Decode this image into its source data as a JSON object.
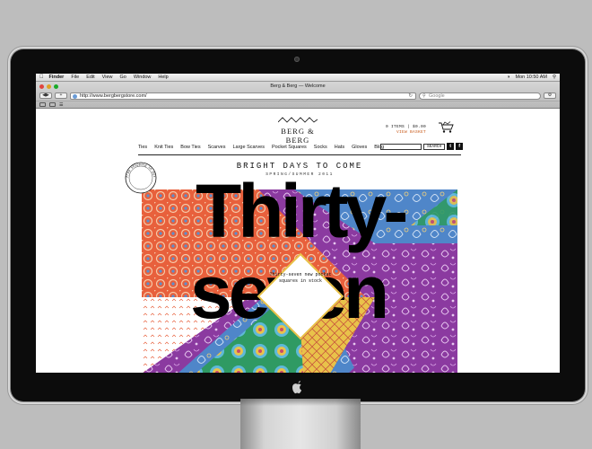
{
  "menubar": {
    "items": [
      "Finder",
      "File",
      "Edit",
      "View",
      "Go",
      "Window",
      "Help"
    ],
    "clock": "Mon 10:50 AM"
  },
  "browser": {
    "window_title": "Berg & Berg — Welcome",
    "url": "http://www.bergbergstore.com/",
    "search_placeholder": "Google"
  },
  "site": {
    "brand": "BERG & BERG",
    "basket_info": "0 ITEMS | $0.00",
    "basket_link": "VIEW BASKET",
    "nav": [
      "Ties",
      "Knit Ties",
      "Bow Ties",
      "Scarves",
      "Large Scarves",
      "Pocket Squares",
      "Socks",
      "Hats",
      "Gloves",
      "Blog"
    ],
    "search_button": "SEARCH",
    "social": [
      "t",
      "f"
    ],
    "hero": {
      "title": "BRIGHT DAYS TO COME",
      "subtitle": "SPRING/SUMMER 2011",
      "stamp_text": "free shipping in Europe",
      "big_word_1": "Thirty-",
      "big_word_2": "seven",
      "center_text": "Thirty-seven new pocket squares in stock"
    }
  },
  "colors": {
    "orange": "#e8603c",
    "purple": "#8b3aa0",
    "blue": "#4f86c9",
    "green": "#2f9a63",
    "yellow": "#e9c24a",
    "link": "#c85a1a"
  }
}
